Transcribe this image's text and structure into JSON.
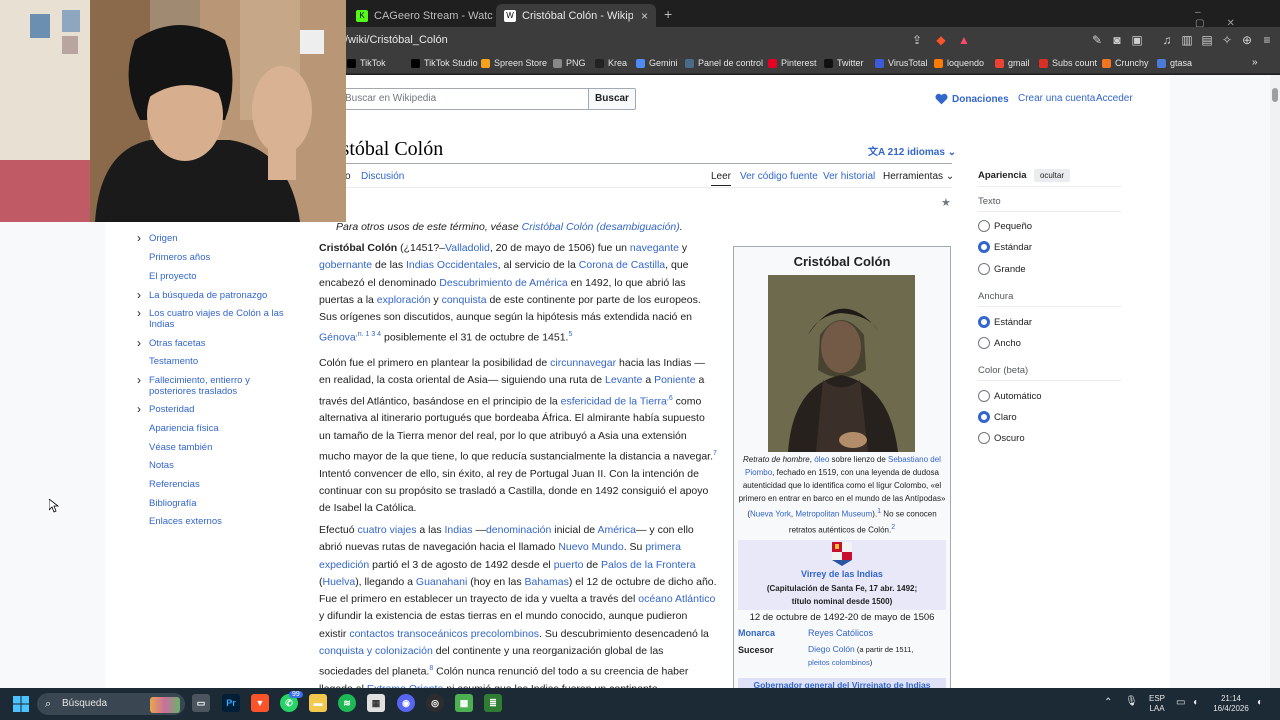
{
  "browser": {
    "tabs": [
      {
        "label": "CAGeero Stream - Watch Live on Kick",
        "active": false
      },
      {
        "label": "Cristóbal Colón - Wikipedia, la e",
        "active": true
      }
    ],
    "new_tab_icon": "+",
    "url": "/wiki/Cristóbal_Colón",
    "bookmarks": [
      "TikTok",
      "TikTok Studio",
      "Spreen Store",
      "PNG",
      "Krea",
      "Gemini",
      "Panel de control",
      "Pinterest",
      "Twitter",
      "VirusTotal",
      "loquendo",
      "gmail",
      "Subs count",
      "Crunchy",
      "gtasa"
    ],
    "bookmark_colors": [
      "#000000",
      "#000000",
      "#f7a21b",
      "#888888",
      "#222222",
      "#4f8cf7",
      "#4a6a8a",
      "#e60023",
      "#111111",
      "#3b5bdb",
      "#ff7a00",
      "#ea4335",
      "#d93025",
      "#f47521",
      "#4a7bd8"
    ]
  },
  "wiki": {
    "search_placeholder": "Buscar en Wikipedia",
    "search_button": "Buscar",
    "donate": "Donaciones",
    "create_account": "Crear una cuenta",
    "login": "Acceder",
    "title": "istóbal Colón",
    "languages": "212 idiomas",
    "tab_article": "o",
    "tab_talk": "Discusión",
    "tab_read": "Leer",
    "tab_source": "Ver código fuente",
    "tab_history": "Ver historial",
    "tab_tools": "Herramientas",
    "hatnote_prefix": "Para otros usos de este término, véase ",
    "hatnote_link": "Cristóbal Colón (desambiguación)",
    "hatnote_suffix": ".",
    "toc": [
      {
        "label": "Origen",
        "chevron": true
      },
      {
        "label": "Primeros años",
        "chevron": false
      },
      {
        "label": "El proyecto",
        "chevron": false
      },
      {
        "label": "La búsqueda de patronazgo",
        "chevron": true
      },
      {
        "label": "Los cuatro viajes de Colón a las Indias",
        "chevron": true
      },
      {
        "label": "Otras facetas",
        "chevron": true
      },
      {
        "label": "Testamento",
        "chevron": false
      },
      {
        "label": "Fallecimiento, entierro y posteriores traslados",
        "chevron": true
      },
      {
        "label": "Posteridad",
        "chevron": true
      },
      {
        "label": "Apariencia física",
        "chevron": false
      },
      {
        "label": "Véase también",
        "chevron": false
      },
      {
        "label": "Notas",
        "chevron": false
      },
      {
        "label": "Referencias",
        "chevron": false
      },
      {
        "label": "Bibliografía",
        "chevron": false
      },
      {
        "label": "Enlaces externos",
        "chevron": false
      }
    ],
    "paragraphs": {
      "p1": [
        {
          "t": "Cristóbal Colón",
          "b": true
        },
        {
          "t": " (¿1451?–"
        },
        {
          "t": "Valladolid",
          "l": true
        },
        {
          "t": ", 20 de mayo de 1506) fue un "
        },
        {
          "t": "navegante",
          "l": true
        },
        {
          "t": " y "
        },
        {
          "t": "gobernante",
          "l": true
        },
        {
          "t": " de las "
        },
        {
          "t": "Indias Occidentales",
          "l": true
        },
        {
          "t": ", al servicio de la "
        },
        {
          "t": "Corona de Castilla",
          "l": true
        },
        {
          "t": ", que encabezó el denominado "
        },
        {
          "t": "Descubrimiento de América",
          "l": true
        },
        {
          "t": " en 1492, lo que abrió las puertas a la "
        },
        {
          "t": "exploración",
          "l": true
        },
        {
          "t": " y "
        },
        {
          "t": "conquista",
          "l": true
        },
        {
          "t": " de este continente por parte de los europeos. Sus orígenes son discutidos, aunque según la hipótesis más extendida nació en "
        },
        {
          "t": "Génova",
          "l": true
        },
        {
          "t": ",n. 1 3 4",
          "s": true
        },
        {
          "t": " posiblemente el 31 de octubre de 1451."
        },
        {
          "t": "5",
          "s": true
        }
      ],
      "p2": [
        {
          "t": "Colón fue el primero en plantear la posibilidad de "
        },
        {
          "t": "circunnavegar",
          "l": true
        },
        {
          "t": " hacia las Indias — en realidad, la costa oriental de Asia— siguiendo una ruta de "
        },
        {
          "t": "Levante",
          "l": true
        },
        {
          "t": " a "
        },
        {
          "t": "Poniente",
          "l": true
        },
        {
          "t": " a través del Atlántico, basándose en el principio de la "
        },
        {
          "t": "esfericidad de la Tierra",
          "l": true
        },
        {
          "t": ",6",
          "s": true
        },
        {
          "t": " como alternativa al itinerario portugués que bordeaba África. El almirante había supuesto un tamaño de la Tierra menor del real, por lo que atribuyó a Asia una extensión mucho mayor de la que tiene, lo que reducía sustancialmente la distancia a navegar."
        },
        {
          "t": "7",
          "s": true
        },
        {
          "t": " Intentó convencer de ello, sin éxito, al rey de Portugal Juan II. Con la intención de continuar con su propósito se trasladó a Castilla, donde en 1492 consiguió el apoyo de Isabel la Católica."
        }
      ],
      "p3": [
        {
          "t": "Efectuó "
        },
        {
          "t": "cuatro viajes",
          "l": true
        },
        {
          "t": " a las "
        },
        {
          "t": "Indias",
          "l": true
        },
        {
          "t": " —"
        },
        {
          "t": "denominación",
          "l": true
        },
        {
          "t": " inicial de "
        },
        {
          "t": "América",
          "l": true
        },
        {
          "t": "— y con ello abrió nuevas rutas de navegación hacia el llamado "
        },
        {
          "t": "Nuevo Mundo",
          "l": true
        },
        {
          "t": ". Su "
        },
        {
          "t": "primera expedición",
          "l": true
        },
        {
          "t": " partió el 3 de agosto de 1492 desde el "
        },
        {
          "t": "puerto",
          "l": true
        },
        {
          "t": " de "
        },
        {
          "t": "Palos de la Frontera",
          "l": true
        },
        {
          "t": " ("
        },
        {
          "t": "Huelva",
          "l": true
        },
        {
          "t": "), llegando a "
        },
        {
          "t": "Guanahani",
          "l": true
        },
        {
          "t": " (hoy en las "
        },
        {
          "t": "Bahamas",
          "l": true
        },
        {
          "t": ") el 12 de octubre de dicho año. Fue el primero en establecer un trayecto de ida y vuelta a través del "
        },
        {
          "t": "océano Atlántico",
          "l": true
        },
        {
          "t": " y difundir la existencia de estas tierras en el mundo conocido, aunque pudieron existir "
        },
        {
          "t": "contactos transoceánicos precolombinos",
          "l": true
        },
        {
          "t": ". Su descubrimiento desencadenó la "
        },
        {
          "t": "conquista y colonización",
          "l": true
        },
        {
          "t": " del continente y una reorganización global de las sociedades del planeta."
        },
        {
          "t": "8",
          "s": true
        },
        {
          "t": " Colón nunca renunció del todo a su creencia de haber llegado al "
        },
        {
          "t": "Extremo Oriente",
          "l": true
        },
        {
          "t": " ni asumió que las Indias fueran un continente"
        }
      ]
    },
    "infobox": {
      "title": "Cristóbal Colón",
      "caption": [
        {
          "t": "Retrato de hombre",
          "i": true
        },
        {
          "t": ", "
        },
        {
          "t": "óleo",
          "l": true
        },
        {
          "t": " sobre lienzo de "
        },
        {
          "t": "Sebastiano del Piombo",
          "l": true
        },
        {
          "t": ", fechado en 1519, con una leyenda de dudosa autenticidad que lo identifica como el lígur Colombo, «el primero en entrar en barco en el mundo de las Antípodas» ("
        },
        {
          "t": "Nueva York",
          "l": true
        },
        {
          "t": ", "
        },
        {
          "t": "Metropolitan Museum",
          "l": true
        },
        {
          "t": ")."
        },
        {
          "t": "1",
          "s": true
        },
        {
          "t": "  No se conocen retratos auténticos de Colón."
        },
        {
          "t": "2",
          "s": true
        }
      ],
      "office": "Virrey de las Indias",
      "office_note_line1": "(Capitulación de Santa Fe, 17 abr. 1492;",
      "office_note_line2": "título nominal desde 1500)",
      "dates": "12 de octubre de 1492-20 de mayo de 1506",
      "monarch_label": "Monarca",
      "monarch_value": "Reyes Católicos",
      "successor_label": "Sucesor",
      "successor_value": "Diego Colón",
      "successor_note": " (a partir de 1511,",
      "successor_value2": "pleitos colombinos",
      "successor_note2": ")",
      "next_office": "Gobernador general del Virreinato de Indias"
    },
    "appearance": {
      "title": "Apariencia",
      "hide": "ocultar",
      "text_label": "Texto",
      "text_options": [
        "Pequeño",
        "Estándar",
        "Grande"
      ],
      "text_selected": 1,
      "width_label": "Anchura",
      "width_options": [
        "Estándar",
        "Ancho"
      ],
      "width_selected": 0,
      "color_label": "Color (beta)",
      "color_options": [
        "Automático",
        "Claro",
        "Oscuro"
      ],
      "color_selected": 1
    }
  },
  "taskbar": {
    "search_label": "Búsqueda",
    "badge_count": "99",
    "lang_line1": "ESP",
    "lang_line2": "LAA",
    "time": "21:14",
    "date": "16/4/2026"
  },
  "colors": {
    "link": "#3366cc",
    "accent": "#3366cc",
    "heart": "#3366cc"
  }
}
